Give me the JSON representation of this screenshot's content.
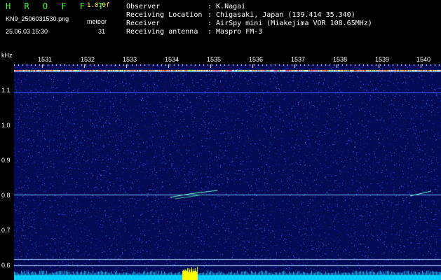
{
  "app": {
    "title": "H R O F F T",
    "version": "1.0.0f",
    "filename": "KN9_2506031530.png",
    "datetime": "25.06.03 15:30",
    "meteor_label": "meteor",
    "meteor_count": "31"
  },
  "meta": [
    {
      "key": "Observer",
      "value": ": K.Nagai"
    },
    {
      "key": "Receiving Location",
      "value": ": Chigasaki, Japan (139.414 35.340)"
    },
    {
      "key": "Receiver",
      "value": ": AirSpy mini (Miakejima VOR 108.65MHz)"
    },
    {
      "key": "Receiving antenna",
      "value": ": Maspro FM-3"
    }
  ],
  "axis": {
    "unit": "kHz",
    "y_labels": [
      "1.1",
      "1.0",
      "0.9",
      "0.8",
      "0.7",
      "0.6"
    ],
    "time_labels": [
      "1531",
      "1532",
      "1533",
      "1534",
      "1535",
      "1536",
      "1537",
      "1538",
      "1539",
      "1540"
    ]
  },
  "colors": {
    "background": "#000000",
    "noise_dark": "#0a1080",
    "noise_mid": "#1a3acc",
    "trace": "#ff3333",
    "meteor": "#66ffcc",
    "bottom_bar": "#00ccff",
    "burst": "#ffff00"
  }
}
